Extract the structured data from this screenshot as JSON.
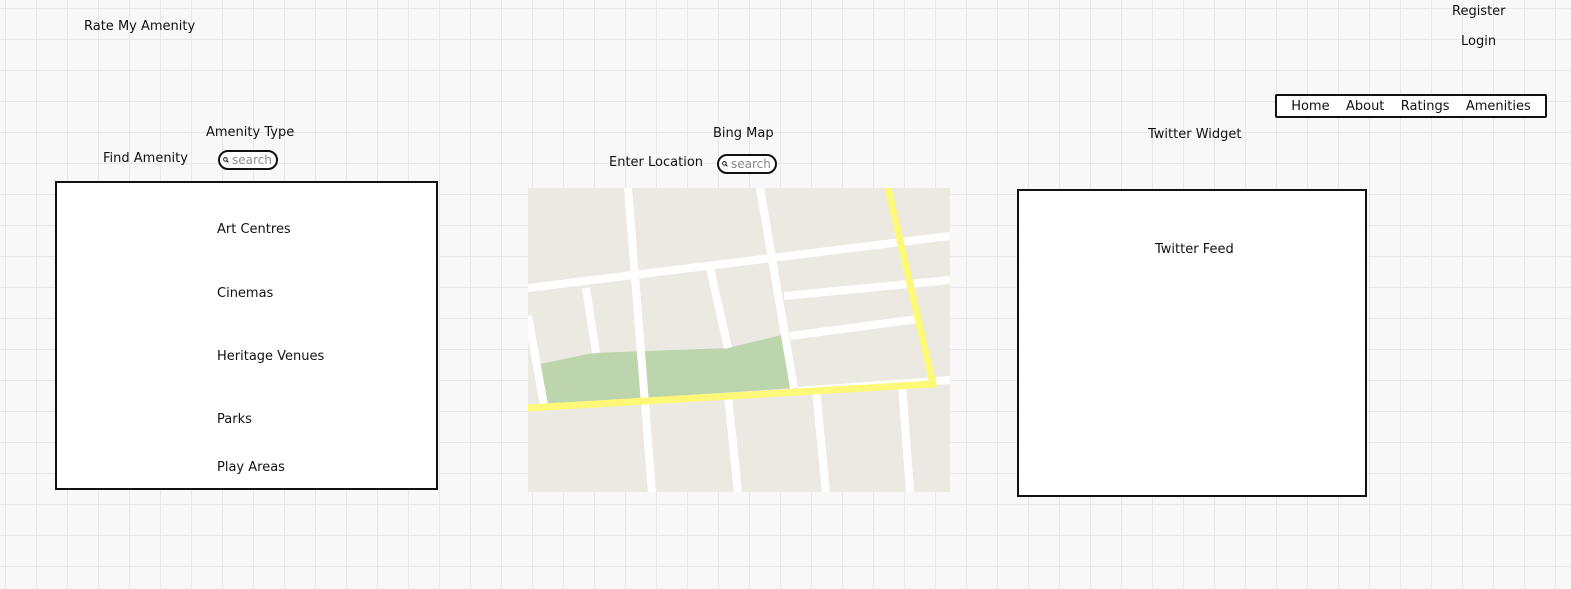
{
  "app_title": "Rate My Amenity",
  "auth": {
    "register": "Register",
    "login": "Login"
  },
  "nav": {
    "items": [
      "Home",
      "About",
      "Ratings",
      "Amenities"
    ]
  },
  "find_amenity": {
    "label": "Find Amenity",
    "type_label": "Amenity Type",
    "search_placeholder": "search",
    "items": [
      "Art Centres",
      "Cinemas",
      "Heritage Venues",
      "Parks",
      "Play Areas"
    ]
  },
  "map": {
    "heading": "Bing Map",
    "location_label": "Enter Location",
    "search_placeholder": "search"
  },
  "twitter": {
    "heading": "Twitter Widget",
    "feed_label": "Twitter Feed"
  },
  "colors": {
    "map_land": "#ebe9e2",
    "map_park": "#bcd5ad",
    "map_highway": "#fdf877",
    "map_street": "#ffffff"
  }
}
